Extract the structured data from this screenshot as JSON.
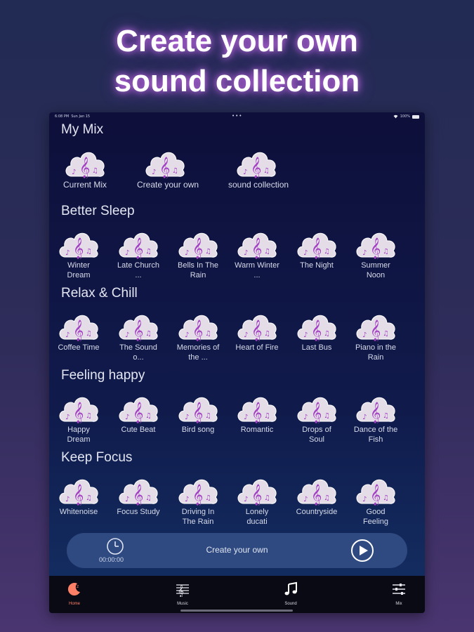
{
  "headline": {
    "line1": "Create your own",
    "line2": "sound collection"
  },
  "status_bar": {
    "time": "6:08 PM",
    "date": "Sun Jan 15",
    "dots": "•••",
    "battery": "100%"
  },
  "icons": {
    "tile": "cloud-music-note-icon",
    "clock": "clock-icon",
    "play": "play-icon"
  },
  "colors": {
    "accent": "#ff8066",
    "player_bg": "#2f4a80",
    "cloud": "#e4dde8",
    "note": "#a33fc2"
  },
  "my_mix": {
    "title": "My Mix",
    "items": [
      {
        "label": "Current Mix"
      },
      {
        "label": "Create your own"
      },
      {
        "label": "sound collection"
      }
    ]
  },
  "sections": [
    {
      "title": "Better Sleep",
      "items": [
        {
          "label": "Winter Dream"
        },
        {
          "label": "Late Church ..."
        },
        {
          "label": "Bells In The Rain"
        },
        {
          "label": "Warm Winter ..."
        },
        {
          "label": "The Night"
        },
        {
          "label": "Summer Noon"
        }
      ]
    },
    {
      "title": "Relax & Chill",
      "items": [
        {
          "label": "Coffee Time"
        },
        {
          "label": "The Sound o..."
        },
        {
          "label": "Memories of the ..."
        },
        {
          "label": "Heart of Fire"
        },
        {
          "label": "Last Bus"
        },
        {
          "label": "Piano in the Rain"
        }
      ]
    },
    {
      "title": "Feeling happy",
      "items": [
        {
          "label": "Happy Dream"
        },
        {
          "label": "Cute Beat"
        },
        {
          "label": "Bird song"
        },
        {
          "label": "Romantic"
        },
        {
          "label": "Drops of Soul"
        },
        {
          "label": "Dance of the Fish"
        }
      ]
    },
    {
      "title": "Keep Focus",
      "items": [
        {
          "label": "Whitenoise"
        },
        {
          "label": "Focus Study"
        },
        {
          "label": "Driving In The Rain"
        },
        {
          "label": "Lonely ducati"
        },
        {
          "label": "Countryside"
        },
        {
          "label": "Good Feeling"
        }
      ]
    }
  ],
  "player": {
    "time": "00:00:00",
    "title": "Create your own"
  },
  "tabs": [
    {
      "label": "Home",
      "icon": "moon-icon",
      "active": true
    },
    {
      "label": "Music",
      "icon": "music-sheet-icon",
      "active": false
    },
    {
      "label": "Sound",
      "icon": "music-note-icon",
      "active": false
    },
    {
      "label": "Mix",
      "icon": "sliders-icon",
      "active": false
    }
  ]
}
